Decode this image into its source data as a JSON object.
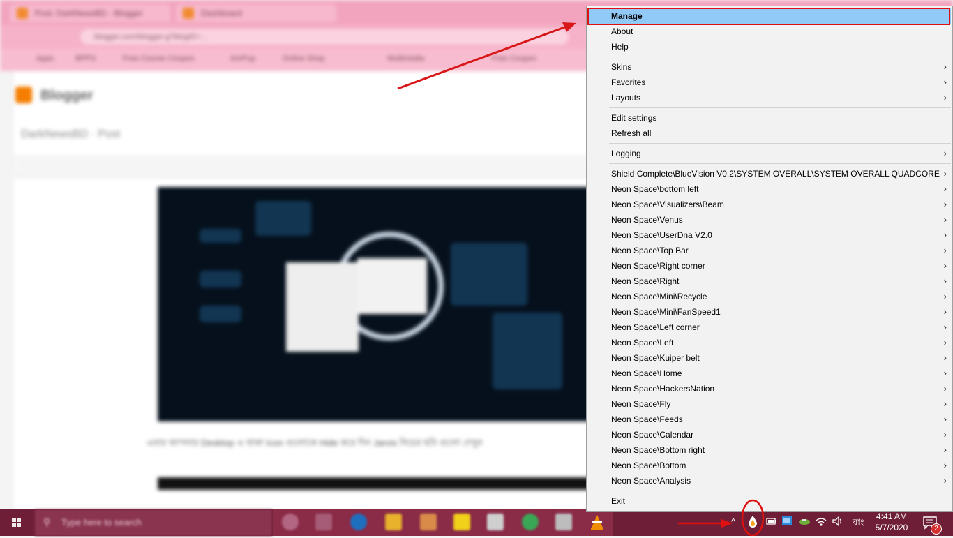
{
  "background": {
    "tabs": [
      "Post: DarkNewsBD - Blogger",
      "Dashboard"
    ],
    "url": "blogger.com/blogger.g?blogID=...",
    "bookmarks": [
      "Apps",
      "BPPS",
      "Free Course Coupon",
      "AmPup",
      "Online Shop",
      "Multimedia",
      "Free Coupon"
    ],
    "app_title": "Blogger",
    "post_label": "DarkNewsBD · Post",
    "colors": {
      "tabstrip": "#f2a4bf",
      "taskbar": "#6e1e36",
      "highlight": "#91c9f7",
      "annotation": "#e01010"
    }
  },
  "menu": {
    "items": [
      {
        "label": "Manage",
        "submenu": false,
        "highlighted": true
      },
      {
        "label": "About",
        "submenu": false
      },
      {
        "label": "Help",
        "submenu": false
      },
      {
        "label": "Skins",
        "submenu": true
      },
      {
        "label": "Favorites",
        "submenu": true
      },
      {
        "label": "Layouts",
        "submenu": true
      },
      {
        "label": "Edit settings",
        "submenu": false
      },
      {
        "label": "Refresh all",
        "submenu": false
      },
      {
        "label": "Logging",
        "submenu": true
      },
      {
        "label": "Shield Complete\\BlueVision V0.2\\SYSTEM OVERALL\\SYSTEM OVERALL QUADCORE",
        "submenu": true
      },
      {
        "label": "Neon Space\\bottom left",
        "submenu": true
      },
      {
        "label": "Neon Space\\Visualizers\\Beam",
        "submenu": true
      },
      {
        "label": "Neon Space\\Venus",
        "submenu": true
      },
      {
        "label": "Neon Space\\UserDna V2.0",
        "submenu": true
      },
      {
        "label": "Neon Space\\Top Bar",
        "submenu": true
      },
      {
        "label": "Neon Space\\Right corner",
        "submenu": true
      },
      {
        "label": "Neon Space\\Right",
        "submenu": true
      },
      {
        "label": "Neon Space\\Mini\\Recycle",
        "submenu": true
      },
      {
        "label": "Neon Space\\Mini\\FanSpeed1",
        "submenu": true
      },
      {
        "label": "Neon Space\\Left corner",
        "submenu": true
      },
      {
        "label": "Neon Space\\Left",
        "submenu": true
      },
      {
        "label": "Neon Space\\Kuiper belt",
        "submenu": true
      },
      {
        "label": "Neon Space\\Home",
        "submenu": true
      },
      {
        "label": "Neon Space\\HackersNation",
        "submenu": true
      },
      {
        "label": "Neon Space\\Fly",
        "submenu": true
      },
      {
        "label": "Neon Space\\Feeds",
        "submenu": true
      },
      {
        "label": "Neon Space\\Calendar",
        "submenu": true
      },
      {
        "label": "Neon Space\\Bottom right",
        "submenu": true
      },
      {
        "label": "Neon Space\\Bottom",
        "submenu": true
      },
      {
        "label": "Neon Space\\Analysis",
        "submenu": true
      },
      {
        "label": "Exit",
        "submenu": false
      }
    ],
    "chevron": "›"
  },
  "taskbar": {
    "search_placeholder": "Type here to search",
    "language": "বাং",
    "time": "4:41 AM",
    "date": "5/7/2020",
    "notification_count": "2",
    "icons": [
      "windows-start-icon",
      "search-icon",
      "cortana-icon",
      "task-view-icon",
      "edge-icon",
      "file-explorer-icon",
      "store-icon",
      "sticky-notes-icon",
      "paint-icon",
      "chrome-icon",
      "cloud-icon",
      "vlc-icon",
      "show-hidden-icons-chevron",
      "rainmeter-icon",
      "battery-icon",
      "network-icon",
      "wifi-icon",
      "volume-icon",
      "action-center-icon"
    ]
  }
}
